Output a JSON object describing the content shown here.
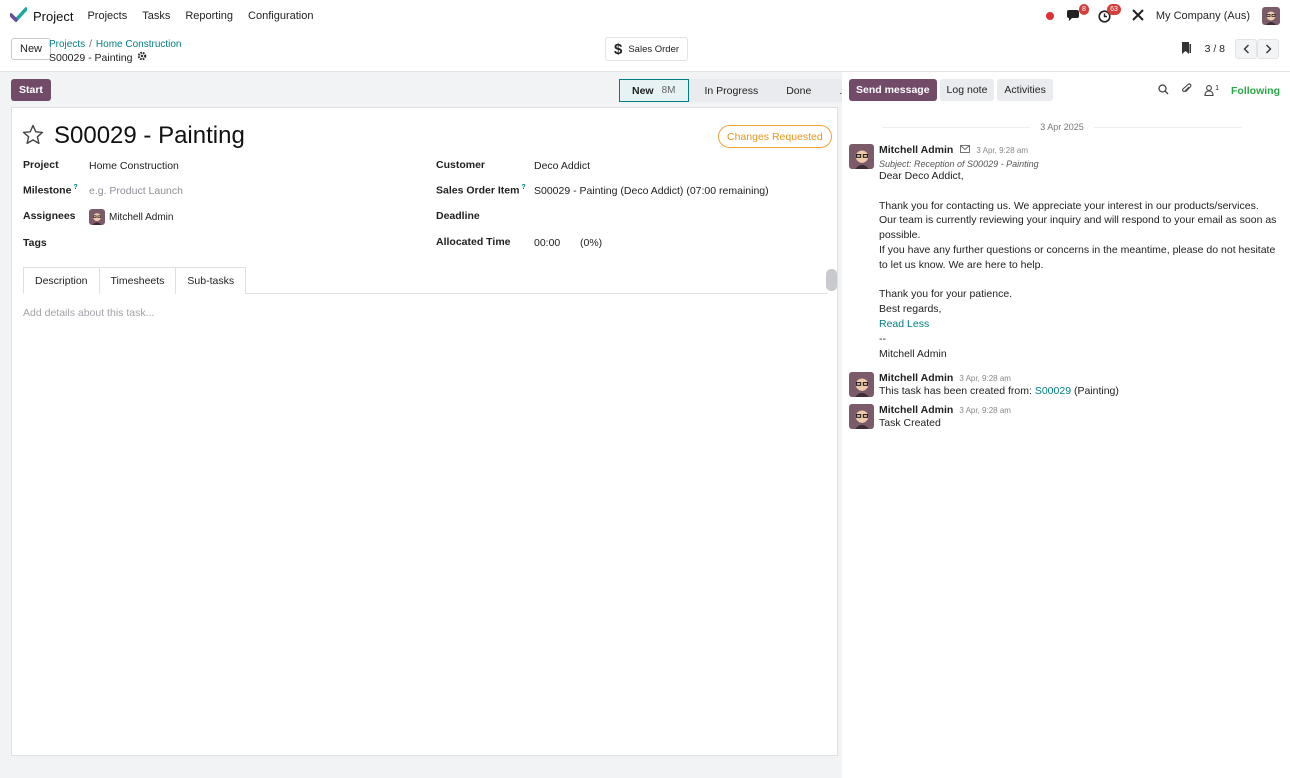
{
  "topbar": {
    "app_name": "Project",
    "menu": [
      "Projects",
      "Tasks",
      "Reporting",
      "Configuration"
    ],
    "messages_badge": "8",
    "activities_badge": "63",
    "company": "My Company (Aus)"
  },
  "control": {
    "new_label": "New",
    "breadcrumb": [
      "Projects",
      "Home Construction"
    ],
    "record": "S00029 - Painting",
    "smart_button": "Sales Order",
    "pager": "3 / 8"
  },
  "status": {
    "start_label": "Start",
    "stages": [
      "New",
      "In Progress",
      "Done",
      "..."
    ],
    "active_count": "8M"
  },
  "form": {
    "title": "S00029 - Painting",
    "state_pill": "Changes Requested",
    "labels": {
      "project": "Project",
      "milestone": "Milestone",
      "assignees": "Assignees",
      "tags": "Tags",
      "customer": "Customer",
      "sales_order_item": "Sales Order Item",
      "deadline": "Deadline",
      "allocated_time": "Allocated Time",
      "help": "?"
    },
    "values": {
      "project": "Home Construction",
      "milestone_placeholder": "e.g. Product Launch",
      "assignee": "Mitchell Admin",
      "customer": "Deco Addict",
      "sales_order_item": "S00029 - Painting (Deco Addict) (07:00 remaining)",
      "allocated_time": "00:00",
      "allocated_pct": "(0%)"
    },
    "tabs": [
      "Description",
      "Timesheets",
      "Sub-tasks"
    ],
    "description_placeholder": "Add details about this task..."
  },
  "chatter": {
    "send_message": "Send message",
    "log_note": "Log note",
    "activities": "Activities",
    "followers_count": "1",
    "following": "Following",
    "date": "3 Apr 2025",
    "messages": [
      {
        "author": "Mitchell Admin",
        "time": "3 Apr, 9:28 am",
        "subject": "Subject: Reception of S00029 - Painting",
        "lines": [
          "Dear Deco Addict,",
          "",
          "Thank you for contacting us. We appreciate your interest in our products/services.",
          "Our team is currently reviewing your inquiry and will respond to your email as soon as",
          "possible.",
          "If you have any further questions or concerns in the meantime, please do not hesitate",
          "to let us know. We are here to help.",
          "",
          "Thank you for your patience.",
          "Best regards,"
        ],
        "read_less": "Read Less",
        "sig": [
          "--",
          "Mitchell Admin"
        ]
      },
      {
        "author": "Mitchell Admin",
        "time": "3 Apr, 9:28 am",
        "prefix": "This task has been created from:",
        "link": "S00029",
        "suffix": "(Painting)"
      },
      {
        "author": "Mitchell Admin",
        "time": "3 Apr, 9:28 am",
        "text": "Task Created"
      }
    ]
  }
}
